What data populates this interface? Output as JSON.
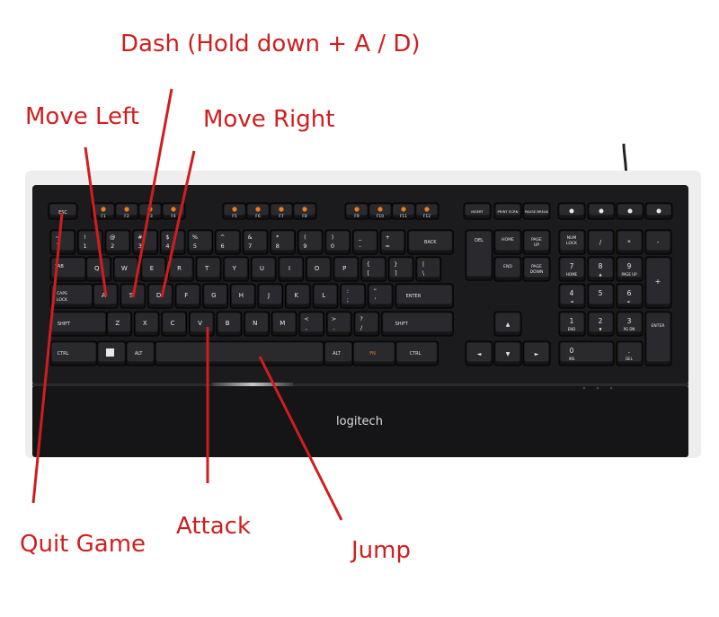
{
  "annotations": {
    "dash": "Dash (Hold down + A / D)",
    "move_left": "Move Left",
    "move_right": "Move Right",
    "quit_game": "Quit Game",
    "attack": "Attack",
    "jump": "Jump"
  },
  "keyboard": {
    "brand": "logitech",
    "fn_row": [
      "ESC",
      "F1",
      "F2",
      "F3",
      "F4",
      "F5",
      "F6",
      "F7",
      "F8",
      "F9",
      "F10",
      "F11",
      "F12"
    ],
    "nav_top": [
      "INSERT",
      "PRINT SCRN",
      "PAUSE BREAK"
    ],
    "media_row": [
      "mute",
      "vol-down",
      "vol-up",
      "light"
    ],
    "number_row": [
      {
        "top": "~",
        "bot": "`"
      },
      {
        "top": "!",
        "bot": "1"
      },
      {
        "top": "@",
        "bot": "2"
      },
      {
        "top": "#",
        "bot": "3"
      },
      {
        "top": "$",
        "bot": "4"
      },
      {
        "top": "%",
        "bot": "5"
      },
      {
        "top": "^",
        "bot": "6"
      },
      {
        "top": "&",
        "bot": "7"
      },
      {
        "top": "*",
        "bot": "8"
      },
      {
        "top": "(",
        "bot": "9"
      },
      {
        "top": ")",
        "bot": "0"
      },
      {
        "top": "_",
        "bot": "-"
      },
      {
        "top": "+",
        "bot": "="
      }
    ],
    "backspace": "BACK",
    "tab": "TAB",
    "row_q": [
      "Q",
      "W",
      "E",
      "R",
      "T",
      "Y",
      "U",
      "I",
      "O",
      "P"
    ],
    "row_q_brackets": [
      {
        "top": "{",
        "bot": "["
      },
      {
        "top": "}",
        "bot": "]"
      },
      {
        "top": "|",
        "bot": "\\"
      }
    ],
    "caps": "CAPS LOCK",
    "row_a": [
      "A",
      "S",
      "D",
      "F",
      "G",
      "H",
      "J",
      "K",
      "L"
    ],
    "row_a_punct": [
      {
        "top": ":",
        "bot": ";"
      },
      {
        "top": "\"",
        "bot": "'"
      }
    ],
    "enter": "ENTER",
    "shift_left": "SHIFT",
    "row_z": [
      "Z",
      "X",
      "C",
      "V",
      "B",
      "N",
      "M"
    ],
    "row_z_punct": [
      {
        "top": "<",
        "bot": ","
      },
      {
        "top": ">",
        "bot": "."
      },
      {
        "top": "?",
        "bot": "/"
      }
    ],
    "shift_right": "SHIFT",
    "bottom_left": [
      "CTRL",
      "win",
      "ALT"
    ],
    "bottom_right": [
      "ALT",
      "FN",
      "CTRL"
    ],
    "nav_block": [
      "DEL",
      "HOME",
      "PAGE UP",
      "END",
      "PAGE DOWN"
    ],
    "numpad": {
      "row1": [
        "NUM LOCK",
        "/",
        "*",
        "-"
      ],
      "row2": [
        "7",
        "8",
        "9"
      ],
      "row2_sub": [
        "HOME",
        "▲",
        "PAGE UP"
      ],
      "row3": [
        "4",
        "5",
        "6"
      ],
      "row3_sub": [
        "◄",
        "",
        "►"
      ],
      "row4": [
        "1",
        "2",
        "3"
      ],
      "row4_sub": [
        "END",
        "▼",
        "PG DN"
      ],
      "row5": [
        "0",
        "."
      ],
      "row5_sub": [
        "INS",
        "DEL"
      ],
      "plus": "+",
      "enter": "ENTER"
    },
    "colors": {
      "body": "#1b1b1d",
      "frame": "#eeeeef",
      "key": "#141416",
      "key_top": "#2a2a2e",
      "legend": "#e8e8e8",
      "fn_accent": "#f07c1e",
      "annotation": "#d01e1e"
    }
  }
}
